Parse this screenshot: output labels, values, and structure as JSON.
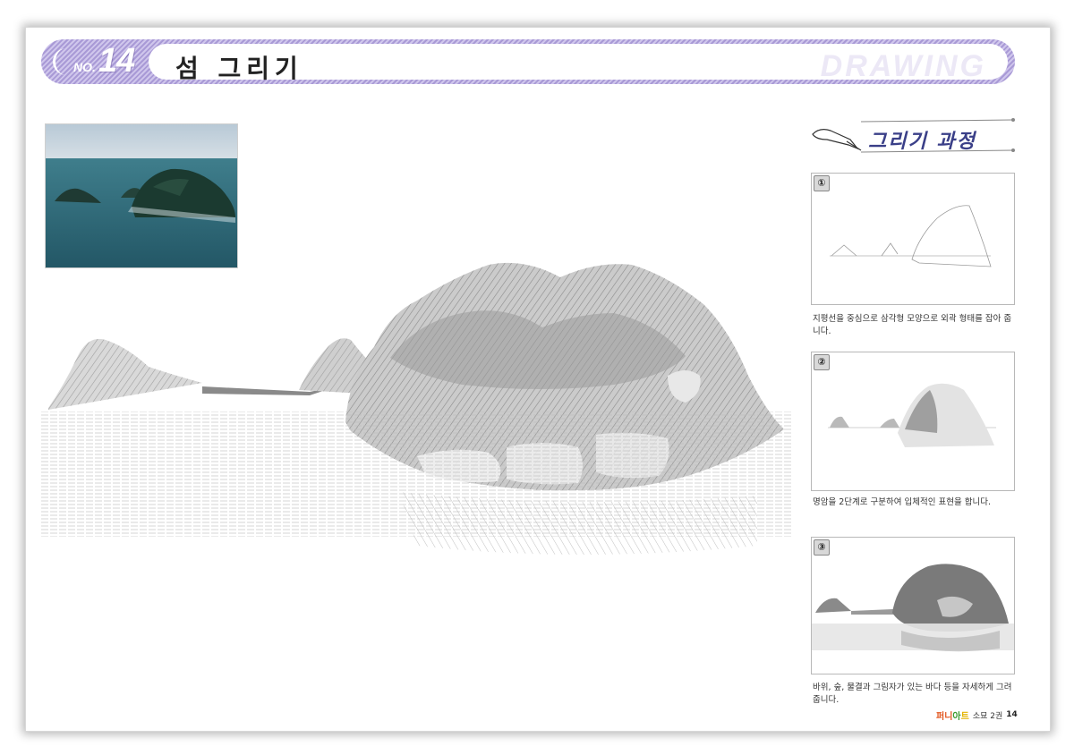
{
  "header": {
    "no_label": "NO.",
    "number": "14",
    "title": "섬 그리기",
    "watermark": "DRAWING"
  },
  "process": {
    "title": "그리기 과정",
    "steps": [
      {
        "number": "①",
        "caption": "지평선을 중심으로 삼각형 모양으로 외곽 형태를 잡아 줍니다."
      },
      {
        "number": "②",
        "caption": "명암을 2단계로 구분하여 입체적인 표현을 합니다."
      },
      {
        "number": "③",
        "caption": "바위, 숲, 물결과 그림자가 있는 바다 등을 자세하게 그려줍니다."
      }
    ]
  },
  "footer": {
    "logo_parts": [
      "퍼니",
      "아",
      "트"
    ],
    "series": "소묘 2권",
    "page": "14"
  },
  "colors": {
    "header_stripe": "#a99ad6",
    "header_stripe_light": "#cfc6ec",
    "process_title": "#3a3f88",
    "sea": "#2f6b7a"
  }
}
